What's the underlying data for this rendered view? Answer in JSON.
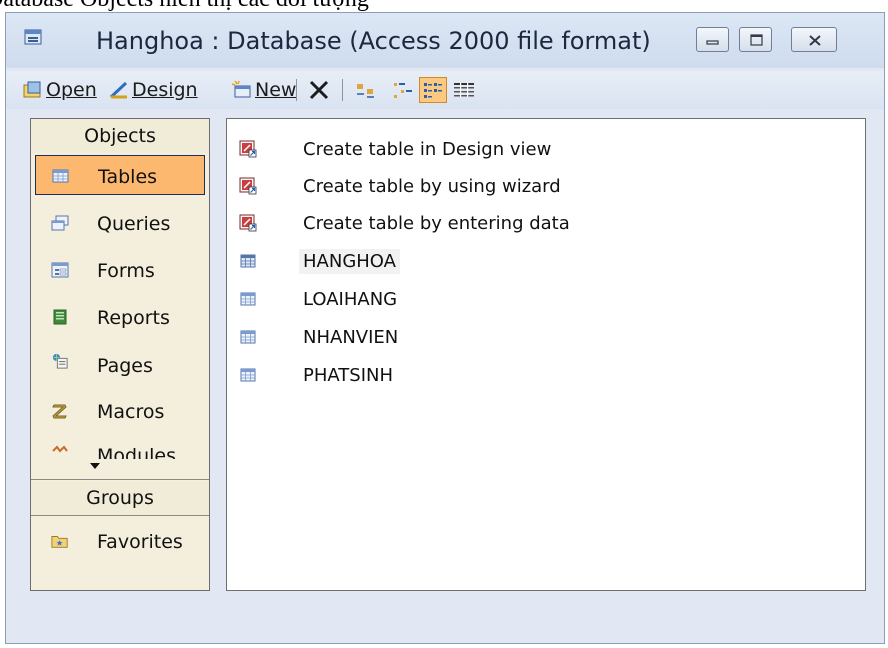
{
  "header_text": "Database Objects hiển thị các đối tượng",
  "window": {
    "title": "Hanghoa : Database (Access 2000 file format)",
    "buttons": [
      "minimize",
      "maximize",
      "close"
    ]
  },
  "toolbar": {
    "open": "Open",
    "design": "Design",
    "new": "New",
    "icons": [
      "open-icon",
      "design-icon",
      "new-icon",
      "delete-icon",
      "large-icons-view-icon",
      "small-icons-view-icon",
      "list-view-icon",
      "details-view-icon"
    ]
  },
  "objects": {
    "header": "Objects",
    "items": [
      {
        "label": "Tables",
        "icon": "table-icon",
        "selected": true
      },
      {
        "label": "Queries",
        "icon": "query-icon"
      },
      {
        "label": "Forms",
        "icon": "form-icon"
      },
      {
        "label": "Reports",
        "icon": "report-icon"
      },
      {
        "label": "Pages",
        "icon": "page-icon"
      },
      {
        "label": "Macros",
        "icon": "macro-icon"
      },
      {
        "label": "Modules",
        "icon": "module-icon"
      }
    ],
    "groups_header": "Groups",
    "favorites": "Favorites"
  },
  "list": {
    "items": [
      {
        "label": "Create table in Design view",
        "icon": "create-shortcut-icon"
      },
      {
        "label": "Create table by using wizard",
        "icon": "create-shortcut-icon"
      },
      {
        "label": "Create table by entering data",
        "icon": "create-shortcut-icon"
      },
      {
        "label": "HANGHOA",
        "icon": "table-icon"
      },
      {
        "label": "LOAIHANG",
        "icon": "table-icon"
      },
      {
        "label": "NHANVIEN",
        "icon": "table-icon"
      },
      {
        "label": "PHATSINH",
        "icon": "table-icon"
      }
    ]
  },
  "colors": {
    "selected": "#fdb870",
    "panel": "#f4efdd",
    "frame": "#e1e8f3"
  }
}
